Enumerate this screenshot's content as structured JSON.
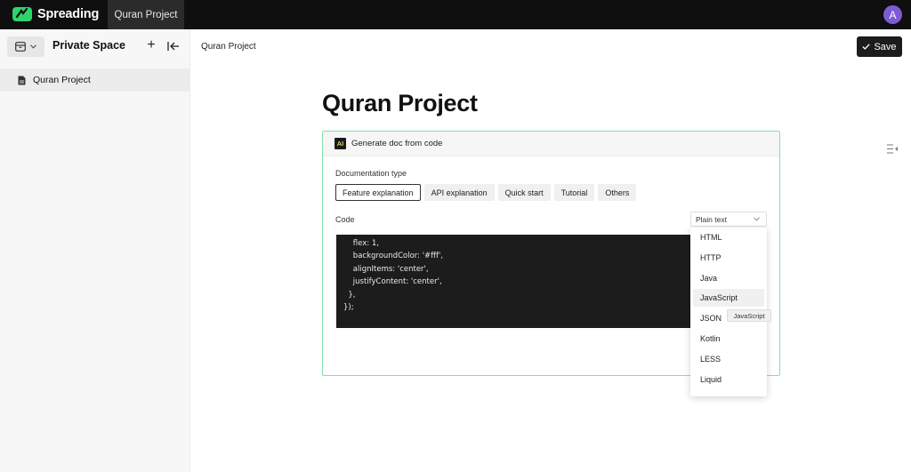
{
  "app": {
    "name": "Spreading",
    "active_tab": "Quran Project",
    "user_initial": "A"
  },
  "sidebar": {
    "space_title": "Private Space",
    "items": [
      {
        "label": "Quran Project"
      }
    ]
  },
  "header": {
    "breadcrumb": "Quran Project",
    "save_label": "Save"
  },
  "doc": {
    "title": "Quran Project"
  },
  "ai_panel": {
    "badge": "AI",
    "title": "Generate doc from code",
    "doc_type_label": "Documentation type",
    "doc_types": [
      "Feature explanation",
      "API explanation",
      "Quick start",
      "Tutorial",
      "Others"
    ],
    "active_doc_type": "Feature explanation",
    "code_label": "Code",
    "selected_language": "Plain text",
    "code_lines": [
      "    flex: 1,",
      "    backgroundColor: '#fff',",
      "    alignItems: 'center',",
      "    justifyContent: 'center',",
      "  },",
      "});"
    ]
  },
  "dropdown": {
    "options": [
      "HTML",
      "HTTP",
      "Java",
      "JavaScript",
      "JSON",
      "Kotlin",
      "LESS",
      "Liquid"
    ],
    "hovered": "JavaScript",
    "tooltip": "JavaScript"
  },
  "colors": {
    "accent_green": "#7fe3a8",
    "topbar": "#0f0f0f",
    "avatar": "#7c5cd6"
  }
}
